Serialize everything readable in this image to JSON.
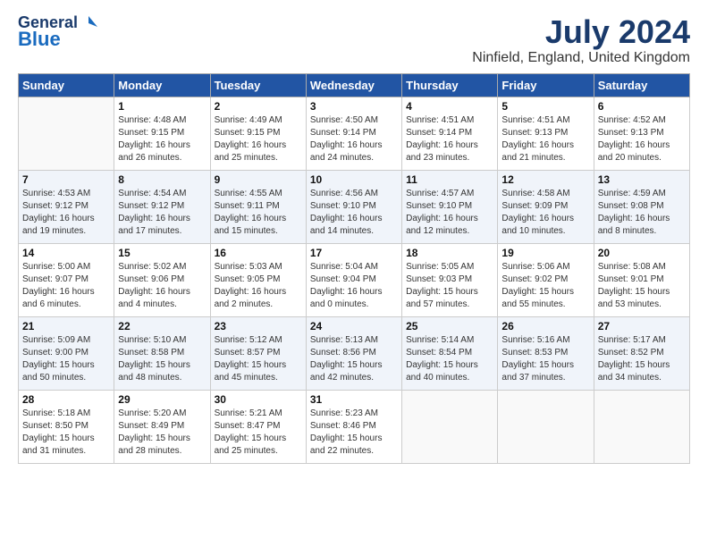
{
  "header": {
    "logo_line1": "General",
    "logo_line2": "Blue",
    "title": "July 2024",
    "subtitle": "Ninfield, England, United Kingdom"
  },
  "columns": [
    "Sunday",
    "Monday",
    "Tuesday",
    "Wednesday",
    "Thursday",
    "Friday",
    "Saturday"
  ],
  "weeks": [
    [
      {
        "date": "",
        "info": ""
      },
      {
        "date": "1",
        "info": "Sunrise: 4:48 AM\nSunset: 9:15 PM\nDaylight: 16 hours and 26 minutes."
      },
      {
        "date": "2",
        "info": "Sunrise: 4:49 AM\nSunset: 9:15 PM\nDaylight: 16 hours and 25 minutes."
      },
      {
        "date": "3",
        "info": "Sunrise: 4:50 AM\nSunset: 9:14 PM\nDaylight: 16 hours and 24 minutes."
      },
      {
        "date": "4",
        "info": "Sunrise: 4:51 AM\nSunset: 9:14 PM\nDaylight: 16 hours and 23 minutes."
      },
      {
        "date": "5",
        "info": "Sunrise: 4:51 AM\nSunset: 9:13 PM\nDaylight: 16 hours and 21 minutes."
      },
      {
        "date": "6",
        "info": "Sunrise: 4:52 AM\nSunset: 9:13 PM\nDaylight: 16 hours and 20 minutes."
      }
    ],
    [
      {
        "date": "7",
        "info": "Sunrise: 4:53 AM\nSunset: 9:12 PM\nDaylight: 16 hours and 19 minutes."
      },
      {
        "date": "8",
        "info": "Sunrise: 4:54 AM\nSunset: 9:12 PM\nDaylight: 16 hours and 17 minutes."
      },
      {
        "date": "9",
        "info": "Sunrise: 4:55 AM\nSunset: 9:11 PM\nDaylight: 16 hours and 15 minutes."
      },
      {
        "date": "10",
        "info": "Sunrise: 4:56 AM\nSunset: 9:10 PM\nDaylight: 16 hours and 14 minutes."
      },
      {
        "date": "11",
        "info": "Sunrise: 4:57 AM\nSunset: 9:10 PM\nDaylight: 16 hours and 12 minutes."
      },
      {
        "date": "12",
        "info": "Sunrise: 4:58 AM\nSunset: 9:09 PM\nDaylight: 16 hours and 10 minutes."
      },
      {
        "date": "13",
        "info": "Sunrise: 4:59 AM\nSunset: 9:08 PM\nDaylight: 16 hours and 8 minutes."
      }
    ],
    [
      {
        "date": "14",
        "info": "Sunrise: 5:00 AM\nSunset: 9:07 PM\nDaylight: 16 hours and 6 minutes."
      },
      {
        "date": "15",
        "info": "Sunrise: 5:02 AM\nSunset: 9:06 PM\nDaylight: 16 hours and 4 minutes."
      },
      {
        "date": "16",
        "info": "Sunrise: 5:03 AM\nSunset: 9:05 PM\nDaylight: 16 hours and 2 minutes."
      },
      {
        "date": "17",
        "info": "Sunrise: 5:04 AM\nSunset: 9:04 PM\nDaylight: 16 hours and 0 minutes."
      },
      {
        "date": "18",
        "info": "Sunrise: 5:05 AM\nSunset: 9:03 PM\nDaylight: 15 hours and 57 minutes."
      },
      {
        "date": "19",
        "info": "Sunrise: 5:06 AM\nSunset: 9:02 PM\nDaylight: 15 hours and 55 minutes."
      },
      {
        "date": "20",
        "info": "Sunrise: 5:08 AM\nSunset: 9:01 PM\nDaylight: 15 hours and 53 minutes."
      }
    ],
    [
      {
        "date": "21",
        "info": "Sunrise: 5:09 AM\nSunset: 9:00 PM\nDaylight: 15 hours and 50 minutes."
      },
      {
        "date": "22",
        "info": "Sunrise: 5:10 AM\nSunset: 8:58 PM\nDaylight: 15 hours and 48 minutes."
      },
      {
        "date": "23",
        "info": "Sunrise: 5:12 AM\nSunset: 8:57 PM\nDaylight: 15 hours and 45 minutes."
      },
      {
        "date": "24",
        "info": "Sunrise: 5:13 AM\nSunset: 8:56 PM\nDaylight: 15 hours and 42 minutes."
      },
      {
        "date": "25",
        "info": "Sunrise: 5:14 AM\nSunset: 8:54 PM\nDaylight: 15 hours and 40 minutes."
      },
      {
        "date": "26",
        "info": "Sunrise: 5:16 AM\nSunset: 8:53 PM\nDaylight: 15 hours and 37 minutes."
      },
      {
        "date": "27",
        "info": "Sunrise: 5:17 AM\nSunset: 8:52 PM\nDaylight: 15 hours and 34 minutes."
      }
    ],
    [
      {
        "date": "28",
        "info": "Sunrise: 5:18 AM\nSunset: 8:50 PM\nDaylight: 15 hours and 31 minutes."
      },
      {
        "date": "29",
        "info": "Sunrise: 5:20 AM\nSunset: 8:49 PM\nDaylight: 15 hours and 28 minutes."
      },
      {
        "date": "30",
        "info": "Sunrise: 5:21 AM\nSunset: 8:47 PM\nDaylight: 15 hours and 25 minutes."
      },
      {
        "date": "31",
        "info": "Sunrise: 5:23 AM\nSunset: 8:46 PM\nDaylight: 15 hours and 22 minutes."
      },
      {
        "date": "",
        "info": ""
      },
      {
        "date": "",
        "info": ""
      },
      {
        "date": "",
        "info": ""
      }
    ]
  ]
}
